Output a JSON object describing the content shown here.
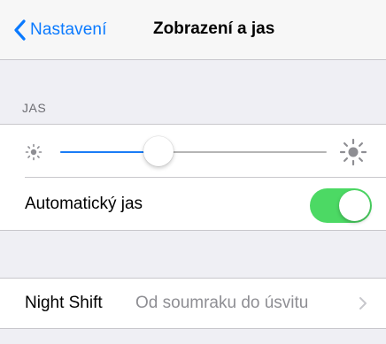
{
  "navbar": {
    "back_label": "Nastavení",
    "title": "Zobrazení a jas",
    "back_icon": "chevron-left-icon"
  },
  "brightness": {
    "section_header": "JAS",
    "level": 0.37,
    "min_icon": "sun-small-icon",
    "max_icon": "sun-large-icon",
    "auto_label": "Automatický jas",
    "auto_enabled": true
  },
  "night_shift": {
    "label": "Night Shift",
    "value": "Od soumraku do úsvitu",
    "disclosure_icon": "chevron-right-icon"
  },
  "colors": {
    "accent": "#0a7aff",
    "toggle_on": "#4cd964",
    "background": "#efeff4",
    "secondary_text": "#8e8e93"
  }
}
